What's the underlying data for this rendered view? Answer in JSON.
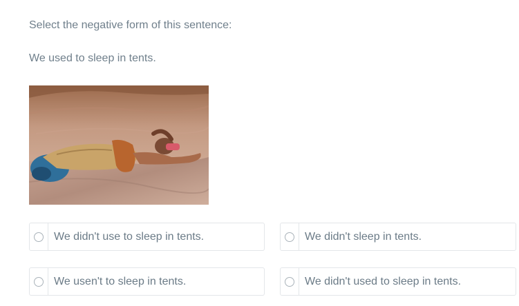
{
  "question": {
    "prompt": "Select the negative form of this sentence:",
    "sentence": "We used to sleep in tents."
  },
  "image": {
    "subject": "man-sleeping-on-rock-ledge"
  },
  "options": [
    {
      "label": "We didn't use to sleep in tents.",
      "selected": false
    },
    {
      "label": "We didn't sleep in tents.",
      "selected": false
    },
    {
      "label": "We usen't to sleep in tents.",
      "selected": false
    },
    {
      "label": "We didn't used to sleep in tents.",
      "selected": false
    }
  ],
  "colors": {
    "text": "#6b7b87",
    "border": "#e3e6e9",
    "radio_border": "#a9b2b9"
  }
}
